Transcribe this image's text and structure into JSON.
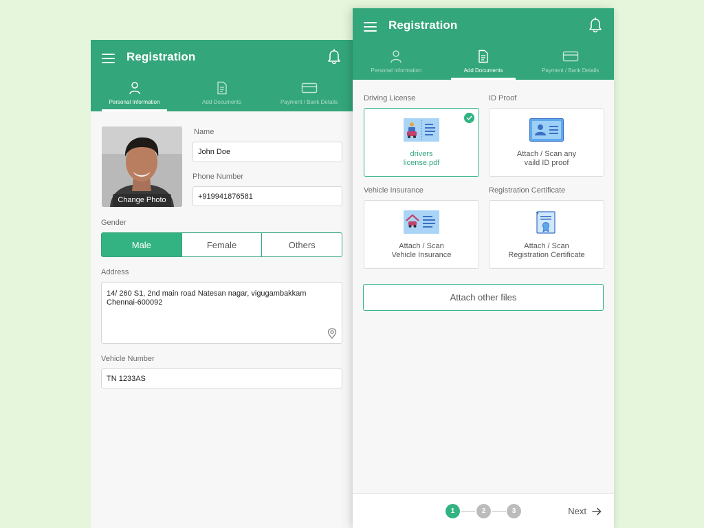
{
  "colors": {
    "background": "#e5f6dc",
    "primary": "#33a67b",
    "accent": "#33b382",
    "surface": "#f7f7f7"
  },
  "app": {
    "title": "Registration"
  },
  "tabs": [
    {
      "label": "Personal Information",
      "icon": "person-icon"
    },
    {
      "label": "Add Documents",
      "icon": "document-icon"
    },
    {
      "label": "Payment / Bank Details",
      "icon": "card-icon"
    }
  ],
  "personal": {
    "change_photo": "Change Photo",
    "name_label": "Name",
    "name_value": "John Doe",
    "phone_label": "Phone Number",
    "phone_value": "+919941876581",
    "gender_label": "Gender",
    "gender_options": [
      "Male",
      "Female",
      "Others"
    ],
    "gender_selected": "Male",
    "address_label": "Address",
    "address_line1": "14/ 260 S1, 2nd main road Natesan nagar, vigugambakkam",
    "address_line2": "Chennai-600092",
    "vehicle_label": "Vehicle Number",
    "vehicle_value": "TN 1233AS"
  },
  "documents": {
    "driving_license": {
      "label": "Driving License",
      "line1": "drivers",
      "line2": "license.pdf",
      "checked": true
    },
    "id_proof": {
      "label": "ID Proof",
      "line1": "Attach / Scan any",
      "line2": "vaild ID proof"
    },
    "vehicle_insurance": {
      "label": "Vehicle Insurance",
      "line1": "Attach / Scan",
      "line2": "Vehicle Insurance"
    },
    "registration_certificate": {
      "label": "Registration Certificate",
      "line1": "Attach / Scan",
      "line2": "Registration Certificate"
    },
    "attach_other": "Attach other files"
  },
  "footer": {
    "steps": [
      "1",
      "2",
      "3"
    ],
    "current_step": "1",
    "next_label": "Next"
  }
}
